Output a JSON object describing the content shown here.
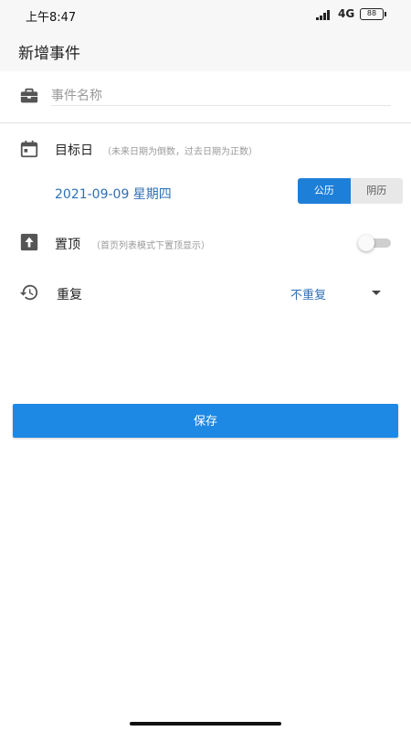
{
  "status_bar": {
    "time": "上午8:47",
    "network": "4G",
    "battery": "88"
  },
  "header": {
    "title": "新增事件"
  },
  "form": {
    "name_placeholder": "事件名称",
    "target_day": {
      "label": "目标日",
      "hint": "（未来日期为倒数，过去日期为正数）",
      "date": "2021-09-09 星期四",
      "calendar_options": [
        "公历",
        "阴历"
      ],
      "selected_calendar": "公历"
    },
    "pin": {
      "label": "置顶",
      "hint": "（首页列表模式下置顶显示）",
      "enabled": false
    },
    "repeat": {
      "label": "重复",
      "value": "不重复"
    }
  },
  "actions": {
    "save_label": "保存"
  },
  "colors": {
    "accent": "#1e88e5",
    "link_text": "#2f6fb5",
    "header_bg": "#f7f7f7"
  },
  "icons": {
    "name_row": "briefcase-icon",
    "target_day_row": "calendar-icon",
    "pin_row": "pin-top-icon",
    "repeat_row": "history-icon"
  }
}
